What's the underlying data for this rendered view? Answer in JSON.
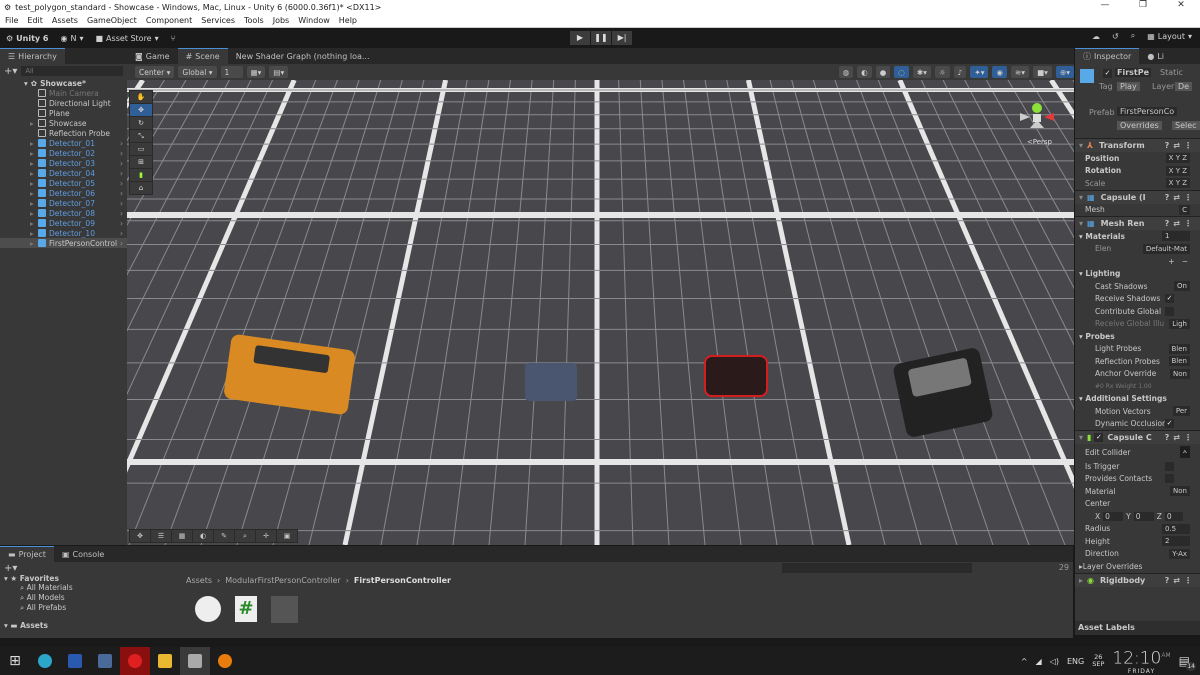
{
  "window": {
    "title": "test_polygon_standard - Showcase - Windows, Mac, Linux - Unity 6 (6000.0.36f1)* <DX11>",
    "controls": [
      "—",
      "❐",
      "✕"
    ]
  },
  "menu": [
    "File",
    "Edit",
    "Assets",
    "GameObject",
    "Component",
    "Services",
    "Tools",
    "Jobs",
    "Window",
    "Help"
  ],
  "toolbar": {
    "unity": "Unity 6",
    "account": "N",
    "asset_store": "Asset Store",
    "layout": "Layout",
    "play": "▶",
    "pause": "❚❚",
    "step": "▶|"
  },
  "hierarchy": {
    "tab": "Hierarchy",
    "search_placeholder": "All",
    "scene": "Showcase*",
    "items": [
      {
        "label": "Main Camera",
        "style": "dim"
      },
      {
        "label": "Directional Light",
        "style": ""
      },
      {
        "label": "Plane",
        "style": ""
      },
      {
        "label": "Showcase",
        "style": "",
        "arrow": true
      },
      {
        "label": "Reflection Probe",
        "style": ""
      },
      {
        "label": "Detector_01",
        "style": "prefab"
      },
      {
        "label": "Detector_02",
        "style": "prefab"
      },
      {
        "label": "Detector_03",
        "style": "prefab"
      },
      {
        "label": "Detector_04",
        "style": "prefab"
      },
      {
        "label": "Detector_05",
        "style": "prefab"
      },
      {
        "label": "Detector_06",
        "style": "prefab"
      },
      {
        "label": "Detector_07",
        "style": "prefab"
      },
      {
        "label": "Detector_08",
        "style": "prefab"
      },
      {
        "label": "Detector_09",
        "style": "prefab"
      },
      {
        "label": "Detector_10",
        "style": "prefab"
      },
      {
        "label": "FirstPersonControl",
        "style": "selected"
      }
    ]
  },
  "scene_tabs": {
    "game": "Game",
    "scene": "Scene",
    "shader": "New Shader Graph (nothing loa..."
  },
  "scene_toolbar": {
    "pivot": "Center",
    "space": "Global",
    "snap": "1",
    "persp_label": "<Persp"
  },
  "inspector": {
    "tab": "Inspector",
    "tab2": "Li",
    "object_name": "FirstPe",
    "static": "Static",
    "tag_label": "Tag",
    "tag": "Play",
    "layer_label": "Layer",
    "layer": "De",
    "prefab_label": "Prefab",
    "prefab": "FirstPersonCo",
    "overrides": "Overrides",
    "select": "Selec",
    "transform": {
      "title": "Transform",
      "rows": [
        "Position",
        "Rotation",
        "Scale"
      ],
      "axes": "X Y Z"
    },
    "capsule_mesh": {
      "title": "Capsule (I",
      "mesh_label": "Mesh",
      "mesh": "C"
    },
    "mesh_renderer": {
      "title": "Mesh Ren",
      "materials_label": "Materials",
      "materials_count": "1",
      "element": "Elen",
      "material": "Default-Mat",
      "lighting": "Lighting",
      "cast_shadows": "Cast Shadows",
      "cast_value": "On",
      "receive_shadows": "Receive Shadows",
      "contribute": "Contribute Global",
      "receive_gi": "Receive Global Illu",
      "receive_gi_value": "Ligh",
      "probes": "Probes",
      "light_probes": "Light Probes",
      "light_probes_value": "Blen",
      "reflection_probes": "Reflection Probes",
      "reflection_value": "Blen",
      "anchor": "Anchor Override",
      "anchor_value": "Non",
      "probe_info": "#0   Rx   Weight 1.00",
      "additional": "Additional Settings",
      "motion_vectors": "Motion Vectors",
      "motion_value": "Per",
      "dynamic_occ": "Dynamic Occlusion"
    },
    "capsule_collider": {
      "title": "Capsule C",
      "edit_collider": "Edit Collider",
      "is_trigger": "Is Trigger",
      "provides_contacts": "Provides Contacts",
      "material": "Material",
      "material_value": "Non",
      "center": "Center",
      "cx": "0",
      "cy": "0",
      "cz": "0",
      "radius_label": "Radius",
      "radius": "0.5",
      "height_label": "Height",
      "height": "2",
      "direction_label": "Direction",
      "direction": "Y-Ax",
      "layer_overrides": "Layer Overrides"
    },
    "rigidbody": {
      "title": "Rigidbody"
    },
    "asset_labels": "Asset Labels"
  },
  "project": {
    "tab": "Project",
    "console": "Console",
    "favorites": "Favorites",
    "fav_items": [
      "All Materials",
      "All Models",
      "All Prefabs"
    ],
    "assets": "Assets",
    "breadcrumb": [
      "Assets",
      "ModularFirstPersonController",
      "FirstPersonController"
    ],
    "count": "29"
  },
  "taskbar": {
    "lang": "ENG",
    "date_day": "26",
    "date_month": "SEP",
    "time": "12:10",
    "ampm": "AM",
    "weekday": "FRIDAY",
    "notifications": "14"
  }
}
